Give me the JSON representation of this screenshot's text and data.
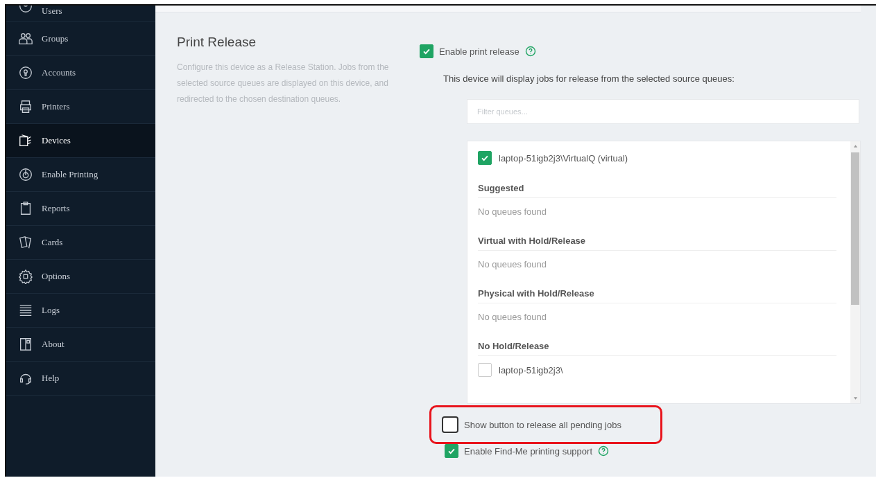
{
  "sidebar": {
    "items": [
      {
        "label": "Users",
        "selected": false
      },
      {
        "label": "Groups",
        "selected": false
      },
      {
        "label": "Accounts",
        "selected": false
      },
      {
        "label": "Printers",
        "selected": false
      },
      {
        "label": "Devices",
        "selected": true
      },
      {
        "label": "Enable Printing",
        "selected": false
      },
      {
        "label": "Reports",
        "selected": false
      },
      {
        "label": "Cards",
        "selected": false
      },
      {
        "label": "Options",
        "selected": false
      },
      {
        "label": "Logs",
        "selected": false
      },
      {
        "label": "About",
        "selected": false
      },
      {
        "label": "Help",
        "selected": false
      }
    ]
  },
  "section": {
    "title": "Print Release",
    "description": "Configure this device as a Release Station. Jobs from the selected source queues are displayed on this device, and redirected to the chosen destination queues."
  },
  "enable_print_release": {
    "label": "Enable print release",
    "checked": true
  },
  "source_prompt": "This device will display jobs for release from the selected source queues:",
  "filter": {
    "placeholder": "Filter queues..."
  },
  "queue_list": [
    {
      "kind": "queue",
      "label": "laptop-51igb2j3\\VirtualQ (virtual)",
      "checked": true
    },
    {
      "kind": "heading",
      "label": "Suggested"
    },
    {
      "kind": "empty",
      "label": "No queues found"
    },
    {
      "kind": "heading",
      "label": "Virtual with Hold/Release"
    },
    {
      "kind": "empty",
      "label": "No queues found"
    },
    {
      "kind": "heading",
      "label": "Physical with Hold/Release"
    },
    {
      "kind": "empty",
      "label": "No queues found"
    },
    {
      "kind": "heading",
      "label": "No Hold/Release"
    },
    {
      "kind": "queue",
      "label": "laptop-51igb2j3\\",
      "checked": false
    }
  ],
  "options": [
    {
      "label": "Show button to release all pending jobs",
      "checked": false,
      "highlighted": true,
      "help": false
    },
    {
      "label": "Enable Find-Me printing support",
      "checked": true,
      "highlighted": false,
      "help": true
    }
  ]
}
